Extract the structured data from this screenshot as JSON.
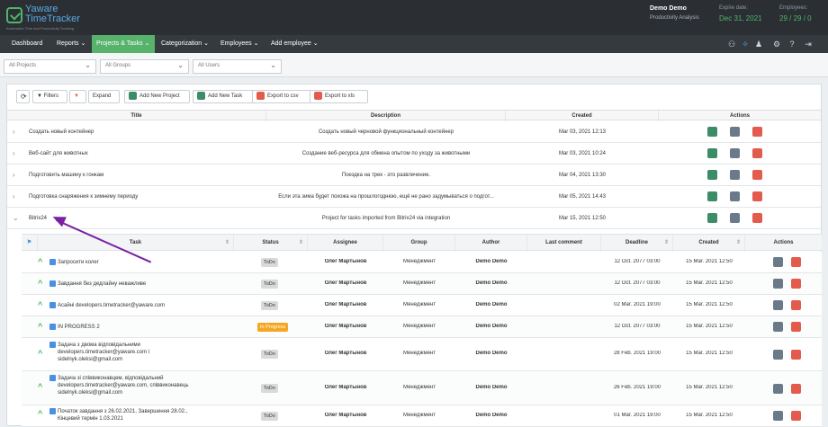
{
  "brand": {
    "line1": "Yaware",
    "line2": "TimeTracker",
    "tagline": "Automated Time and Productivity Tracking"
  },
  "account": {
    "name": "Demo Demo",
    "subtitle": "Productivity Analysis",
    "expire_label": "Expire date:",
    "expire_value": "Dec 31, 2021",
    "employees_label": "Employees:",
    "employees_value": "29 / 29 / 0"
  },
  "menu": [
    {
      "label": "Dashboard"
    },
    {
      "label": "Reports ⌄"
    },
    {
      "label": "Projects & Tasks ⌄"
    },
    {
      "label": "Categorization ⌄"
    },
    {
      "label": "Employees ⌄"
    },
    {
      "label": "Add employee ⌄"
    }
  ],
  "filters": {
    "projects": "All Projects",
    "groups": "All Groups",
    "users": "All Users"
  },
  "toolbar": {
    "filters": "Filters",
    "expand": "Expand",
    "add_project": "Add New Project",
    "add_task": "Add New Task",
    "export_csv": "Export to csv",
    "export_xls": "Export to xls"
  },
  "project_headers": {
    "title": "Title",
    "description": "Description",
    "created": "Created",
    "actions": "Actions"
  },
  "projects": [
    {
      "title": "Создать новый контейнер",
      "description": "Создать новый черновой функциональный контейнер",
      "created": "Mar 03, 2021 12:13"
    },
    {
      "title": "Веб-сайт для животных",
      "description": "Создание веб-ресурса для обмена опытом по уходу за животными",
      "created": "Mar 03, 2021 10:24"
    },
    {
      "title": "Подготовить машину к гонкам",
      "description": "Поездка на трек - это развлечение.",
      "created": "Mar 04, 2021 13:30"
    },
    {
      "title": "Подготовка снаряжения к зимнему периоду",
      "description": "Если эта зима будет похожа на прошлогоднюю, ещё не рано задумываться о подгот...",
      "created": "Mar 05, 2021 14:43"
    },
    {
      "title": "Bitrix24",
      "description": "Project for tasks imported from Bitrix24 via integration",
      "created": "Mar 15, 2021 12:50"
    }
  ],
  "task_headers": {
    "task": "Task",
    "status": "Status",
    "assignee": "Assignee",
    "group": "Group",
    "author": "Author",
    "last_comment": "Last comment",
    "deadline": "Deadline",
    "created": "Created",
    "actions": "Actions"
  },
  "tasks": [
    {
      "name": "Запросити колег",
      "status": "ToDo",
      "assignee": "Олег Мартынов",
      "group": "Менеджмент",
      "author": "Demo Demo",
      "deadline": "12 Oct. 2077 03:00",
      "created": "15 Mar. 2021 12:50"
    },
    {
      "name": "Завдання без дедлайну неважливе",
      "status": "ToDo",
      "assignee": "Олег Мартынов",
      "group": "Менеджмент",
      "author": "Demo Demo",
      "deadline": "12 Oct. 2077 03:00",
      "created": "15 Mar. 2021 12:50"
    },
    {
      "name": "Асайні developers.timetracker@yaware.com",
      "status": "ToDo",
      "assignee": "Олег Мартынов",
      "group": "Менеджмент",
      "author": "Demo Demo",
      "deadline": "02 Mar. 2021 19:00",
      "created": "15 Mar. 2021 12:50"
    },
    {
      "name": "IN PROGRESS 2",
      "status": "In Progress",
      "assignee": "Олег Мартынов",
      "group": "Менеджмент",
      "author": "Demo Demo",
      "deadline": "12 Oct. 2077 03:00",
      "created": "15 Mar. 2021 12:50"
    },
    {
      "name": "Задача з двома відповідальними developers.timetracker@yaware.com і sidelnyk.oleksi@gmail.com",
      "status": "ToDo",
      "assignee": "Олег Мартынов",
      "group": "Менеджмент",
      "author": "Demo Demo",
      "deadline": "28 Feb. 2021 19:00",
      "created": "15 Mar. 2021 12:50"
    },
    {
      "name": "Задача зі співвиконавцем, відповідальний developers.timetracker@yaware.com, співвиконавець sidelnyk.oleksi@gmail.com",
      "status": "ToDo",
      "assignee": "Олег Мартынов",
      "group": "Менеджмент",
      "author": "Demo Demo",
      "deadline": "26 Feb. 2021 19:00",
      "created": "15 Mar. 2021 12:50"
    },
    {
      "name": "Початок завдання з 26.02.2021, Завершення 28.02., Кінцевий термін 1.03.2021",
      "status": "ToDo",
      "assignee": "Олег Мартынов",
      "group": "Менеджмент",
      "author": "Demo Demo",
      "deadline": "01 Mar. 2021 19:00",
      "created": "15 Mar. 2021 12:50"
    }
  ],
  "colors": {
    "accent": "#57b26c",
    "brand_blue": "#5aa9e6",
    "annotation": "#7a1fa2"
  }
}
